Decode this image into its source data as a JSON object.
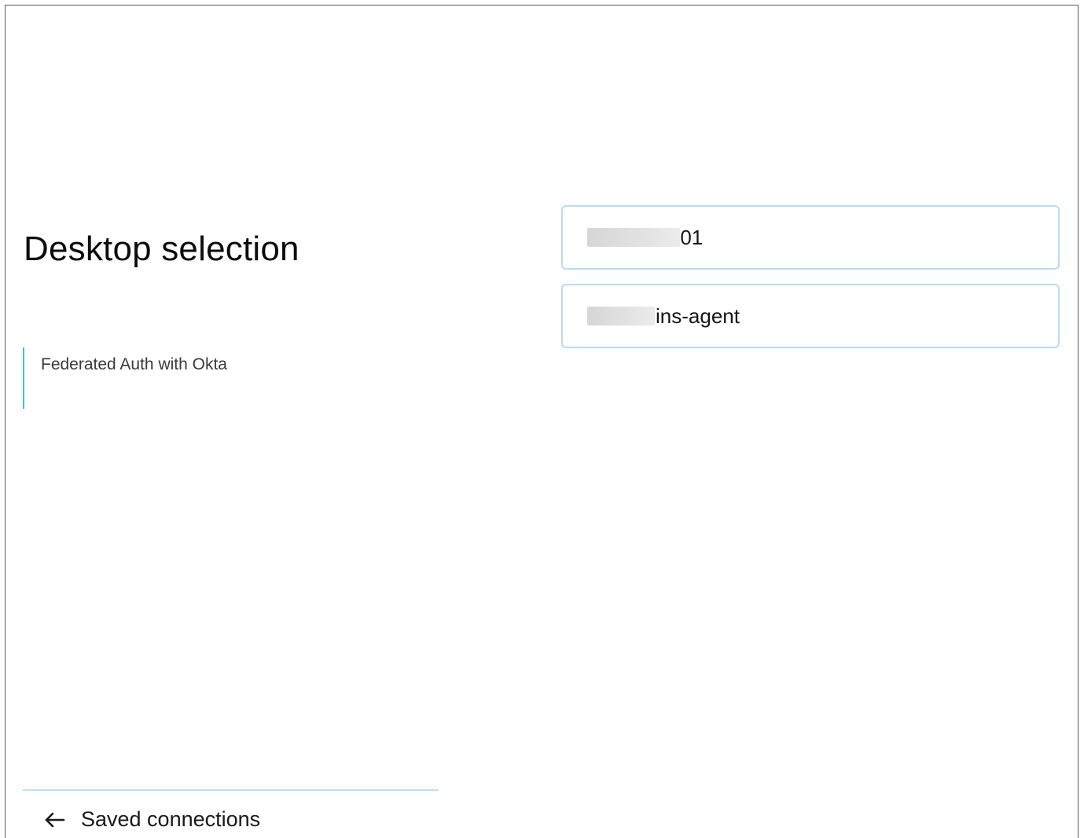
{
  "page": {
    "title": "Desktop selection"
  },
  "auth": {
    "label": "Federated Auth with Okta"
  },
  "desktops": [
    {
      "name": "nt-01"
    },
    {
      "name": "ins-agent"
    }
  ],
  "footer": {
    "back_label": "Saved connections",
    "back_icon": "arrow-left-icon"
  },
  "colors": {
    "accent": "#3cc3d6",
    "card_border": "#b9dcef",
    "divider": "#bfe0ee"
  }
}
